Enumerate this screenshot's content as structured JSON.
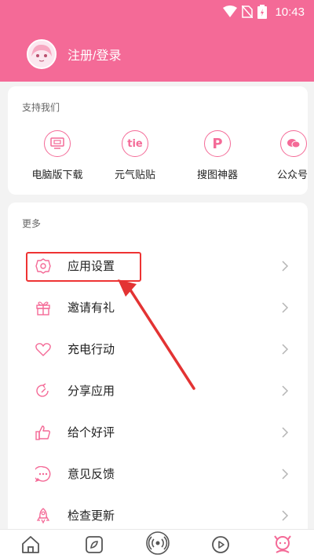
{
  "statusbar": {
    "time": "10:43"
  },
  "user": {
    "login_label": "注册/登录"
  },
  "support": {
    "title": "支持我们",
    "items": [
      {
        "label": "电脑版下载",
        "icon": "monitor-icon"
      },
      {
        "label": "元气贴贴",
        "icon": "tie-icon",
        "icon_text": "tie"
      },
      {
        "label": "搜图神器",
        "icon": "p-logo-icon",
        "icon_text": "P"
      },
      {
        "label": "公众号",
        "icon": "wechat-icon"
      }
    ]
  },
  "more": {
    "title": "更多",
    "items": [
      {
        "label": "应用设置",
        "icon": "settings-gear-icon"
      },
      {
        "label": "邀请有礼",
        "icon": "gift-icon"
      },
      {
        "label": "充电行动",
        "icon": "heart-icon"
      },
      {
        "label": "分享应用",
        "icon": "share-icon"
      },
      {
        "label": "给个好评",
        "icon": "thumbs-up-icon"
      },
      {
        "label": "意见反馈",
        "icon": "feedback-icon"
      },
      {
        "label": "检查更新",
        "icon": "rocket-icon"
      }
    ]
  },
  "nav": {
    "items": [
      "home-icon",
      "discover-icon",
      "radio-icon",
      "play-icon",
      "profile-icon"
    ]
  },
  "colors": {
    "accent": "#f46a97",
    "annotation": "#e33333"
  }
}
